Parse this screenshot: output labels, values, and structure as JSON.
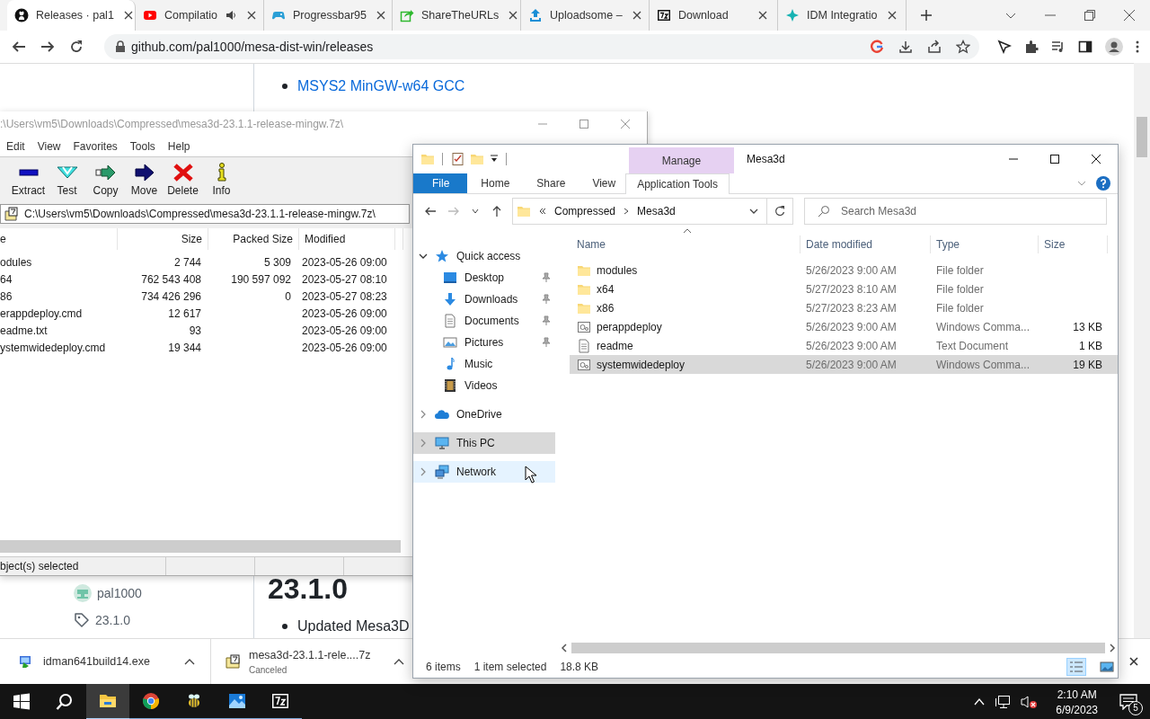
{
  "browser": {
    "tabs": [
      {
        "title": "Releases · pal1",
        "kind": "github",
        "selected": true,
        "audio": false
      },
      {
        "title": "Compilatio",
        "kind": "youtube",
        "selected": false,
        "audio": true
      },
      {
        "title": "Progressbar95",
        "kind": "gamepad",
        "selected": false,
        "audio": false
      },
      {
        "title": "ShareTheURLs",
        "kind": "share",
        "selected": false,
        "audio": false
      },
      {
        "title": "Uploadsome –",
        "kind": "upload",
        "selected": false,
        "audio": false
      },
      {
        "title": "Download",
        "kind": "sevenzip",
        "selected": false,
        "audio": false
      },
      {
        "title": "IDM Integratio",
        "kind": "idm",
        "selected": false,
        "audio": false
      }
    ],
    "url": "github.com/pal1000/mesa-dist-win/releases"
  },
  "page": {
    "links": [
      "MSYS2 MinGW-w64 GCC"
    ],
    "heading": "23.1.0",
    "author": "pal1000",
    "tag": "23.1.0",
    "bullets": [
      "Updated Mesa3D"
    ]
  },
  "archiver": {
    "title": ":\\Users\\vm5\\Downloads\\Compressed\\mesa3d-23.1.1-release-mingw.7z\\",
    "menu": [
      "Edit",
      "View",
      "Favorites",
      "Tools",
      "Help"
    ],
    "tools": [
      {
        "label": "Extract",
        "kind": "extract"
      },
      {
        "label": "Test",
        "kind": "test"
      },
      {
        "label": "Copy",
        "kind": "copy"
      },
      {
        "label": "Move",
        "kind": "move"
      },
      {
        "label": "Delete",
        "kind": "delete"
      },
      {
        "label": "Info",
        "kind": "info"
      }
    ],
    "path": "C:\\Users\\vm5\\Downloads\\Compressed\\mesa3d-23.1.1-release-mingw.7z\\",
    "columns": [
      "e",
      "Size",
      "Packed Size",
      "Modified"
    ],
    "rows": [
      {
        "name": "odules",
        "size": "2 744",
        "packed": "5 309",
        "modified": "2023-05-26 09:00"
      },
      {
        "name": "64",
        "size": "762 543 408",
        "packed": "190 597 092",
        "modified": "2023-05-27 08:10"
      },
      {
        "name": "86",
        "size": "734 426 296",
        "packed": "0",
        "modified": "2023-05-27 08:23"
      },
      {
        "name": "erappdeploy.cmd",
        "size": "12 617",
        "modified": "2023-05-26 09:00"
      },
      {
        "name": "eadme.txt",
        "size": "93",
        "modified": "2023-05-26 09:00"
      },
      {
        "name": "ystemwidedeploy.cmd",
        "size": "19 344",
        "modified": "2023-05-26 09:00"
      }
    ],
    "status": "bject(s) selected"
  },
  "explorer": {
    "context_tab": "Manage",
    "title": "Mesa3d",
    "ribbon_tabs": [
      {
        "label": "File",
        "kind": "file"
      },
      {
        "label": "Home",
        "kind": "tab"
      },
      {
        "label": "Share",
        "kind": "tab"
      },
      {
        "label": "View",
        "kind": "tab"
      },
      {
        "label": "Application Tools",
        "kind": "context"
      }
    ],
    "breadcrumb": [
      "Compressed",
      "Mesa3d"
    ],
    "search_placeholder": "Search Mesa3d",
    "nav": [
      {
        "label": "Quick access",
        "kind": "star",
        "expanded": true,
        "selected": false,
        "hovered": false,
        "children": [
          {
            "label": "Desktop",
            "kind": "desktop",
            "pinned": true,
            "selected": false,
            "hovered": false
          },
          {
            "label": "Downloads",
            "kind": "downloads",
            "pinned": true,
            "selected": false,
            "hovered": false
          },
          {
            "label": "Documents",
            "kind": "documents",
            "pinned": true,
            "selected": false,
            "hovered": false
          },
          {
            "label": "Pictures",
            "kind": "pictures",
            "pinned": true,
            "selected": false,
            "hovered": false
          },
          {
            "label": "Music",
            "kind": "music",
            "pinned": false,
            "selected": false,
            "hovered": false
          },
          {
            "label": "Videos",
            "kind": "videos",
            "pinned": false,
            "selected": false,
            "hovered": false
          }
        ]
      },
      {
        "label": "OneDrive",
        "kind": "cloud",
        "expanded": false,
        "selected": false,
        "hovered": false
      },
      {
        "label": "This PC",
        "kind": "pc",
        "expanded": false,
        "selected": true,
        "hovered": false
      },
      {
        "label": "Network",
        "kind": "network",
        "expanded": false,
        "selected": false,
        "hovered": true
      }
    ],
    "columns": [
      "Name",
      "Date modified",
      "Type",
      "Size"
    ],
    "files": [
      {
        "name": "modules",
        "date": "5/26/2023 9:00 AM",
        "type": "File folder",
        "kind": "folder",
        "selected": false
      },
      {
        "name": "x64",
        "date": "5/27/2023 8:10 AM",
        "type": "File folder",
        "kind": "folder",
        "selected": false
      },
      {
        "name": "x86",
        "date": "5/27/2023 8:23 AM",
        "type": "File folder",
        "kind": "folder",
        "selected": false
      },
      {
        "name": "perappdeploy",
        "date": "5/26/2023 9:00 AM",
        "type": "Windows Comma...",
        "size": "13 KB",
        "kind": "cmd",
        "selected": false
      },
      {
        "name": "readme",
        "date": "5/26/2023 9:00 AM",
        "type": "Text Document",
        "size": "1 KB",
        "kind": "text",
        "selected": false
      },
      {
        "name": "systemwidedeploy",
        "date": "5/26/2023 9:00 AM",
        "type": "Windows Comma...",
        "size": "19 KB",
        "kind": "cmd",
        "selected": true
      }
    ],
    "status": {
      "count": "6 items",
      "selection": "1 item selected",
      "size": "18.8 KB"
    }
  },
  "downloads": [
    {
      "name": "idman641build14.exe",
      "kind": "installer"
    },
    {
      "name": "mesa3d-23.1.1-rele....7z",
      "status": "Canceled",
      "kind": "archive"
    }
  ],
  "taskbar": {
    "apps": [
      {
        "kind": "start",
        "running": false,
        "active": false
      },
      {
        "kind": "search",
        "running": false,
        "active": false
      },
      {
        "kind": "explorer",
        "running": true,
        "active": true
      },
      {
        "kind": "chrome",
        "running": true,
        "active": false
      },
      {
        "kind": "bee",
        "running": true,
        "active": false
      },
      {
        "kind": "photos",
        "running": true,
        "active": false
      },
      {
        "kind": "sevenzip",
        "running": true,
        "active": false
      }
    ],
    "time": "2:10 AM",
    "date": "6/9/2023",
    "notifications": "5"
  }
}
